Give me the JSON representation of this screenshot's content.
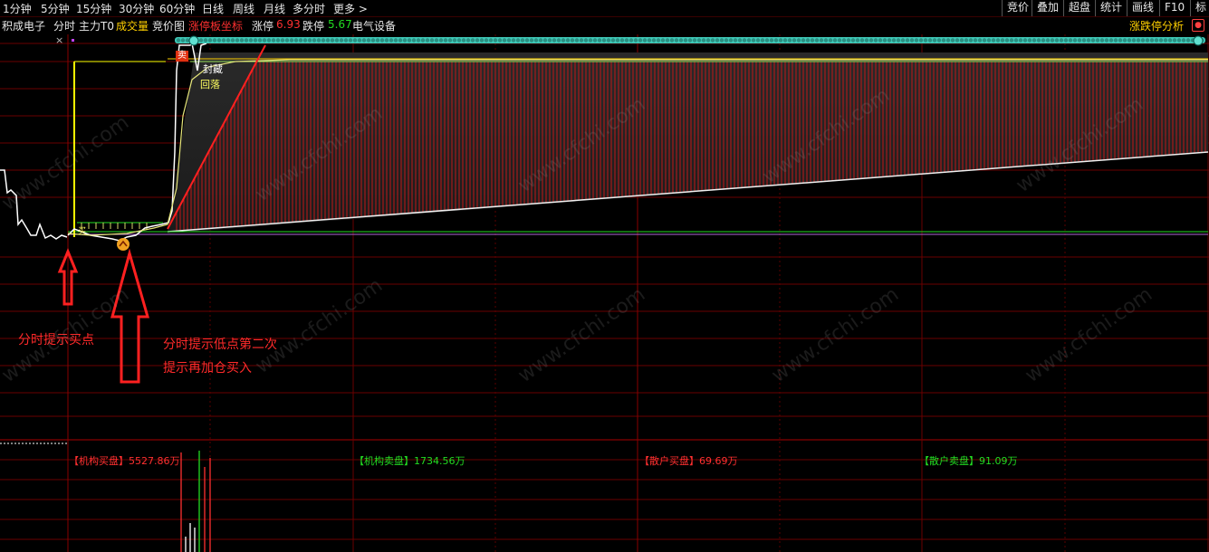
{
  "toolbar": {
    "periods": [
      "1分钟",
      "5分钟",
      "15分钟",
      "30分钟",
      "60分钟",
      "日线",
      "周线",
      "月线",
      "多分时",
      "更多 >"
    ],
    "right_buttons": [
      "竞价",
      "叠加",
      "超盘",
      "统计",
      "画线",
      "F10",
      "标"
    ]
  },
  "infobar": {
    "stock_name": "积成电子",
    "tabs": [
      "分时",
      "主力T0",
      "成交量",
      "竞价图"
    ],
    "indicator": "涨停板坐标",
    "up_limit_label": "涨停",
    "up_limit_value": "6.93",
    "down_limit_label": "跌停",
    "down_limit_value": "5.67",
    "sector": "电气设备",
    "analysis_button": "涨跌停分析",
    "close_symbol": "×"
  },
  "chart": {
    "markers": {
      "buy_red": "卖",
      "seal": "封藏",
      "pullback": "回落",
      "buy_small": "买"
    },
    "annotation_1": "分时提示买点",
    "annotation_2_line1": "分时提示低点第二次",
    "annotation_2_line2": "提示再加仓买入",
    "flows": [
      {
        "label": "【机构买盘】",
        "value": "5527.86万",
        "color": "#ff3030"
      },
      {
        "label": "【机构卖盘】",
        "value": "1734.56万",
        "color": "#22dd22"
      },
      {
        "label": "【散户买盘】",
        "value": "69.69万",
        "color": "#ff3030"
      },
      {
        "label": "【散户卖盘】",
        "value": "91.09万",
        "color": "#22dd22"
      }
    ],
    "watermark": "www.cfchi.com"
  },
  "colors": {
    "up": "#ff3030",
    "down": "#22dd22",
    "grid": "#6a0000",
    "accent": "#ffd000",
    "teal": "#3fc9b8"
  }
}
